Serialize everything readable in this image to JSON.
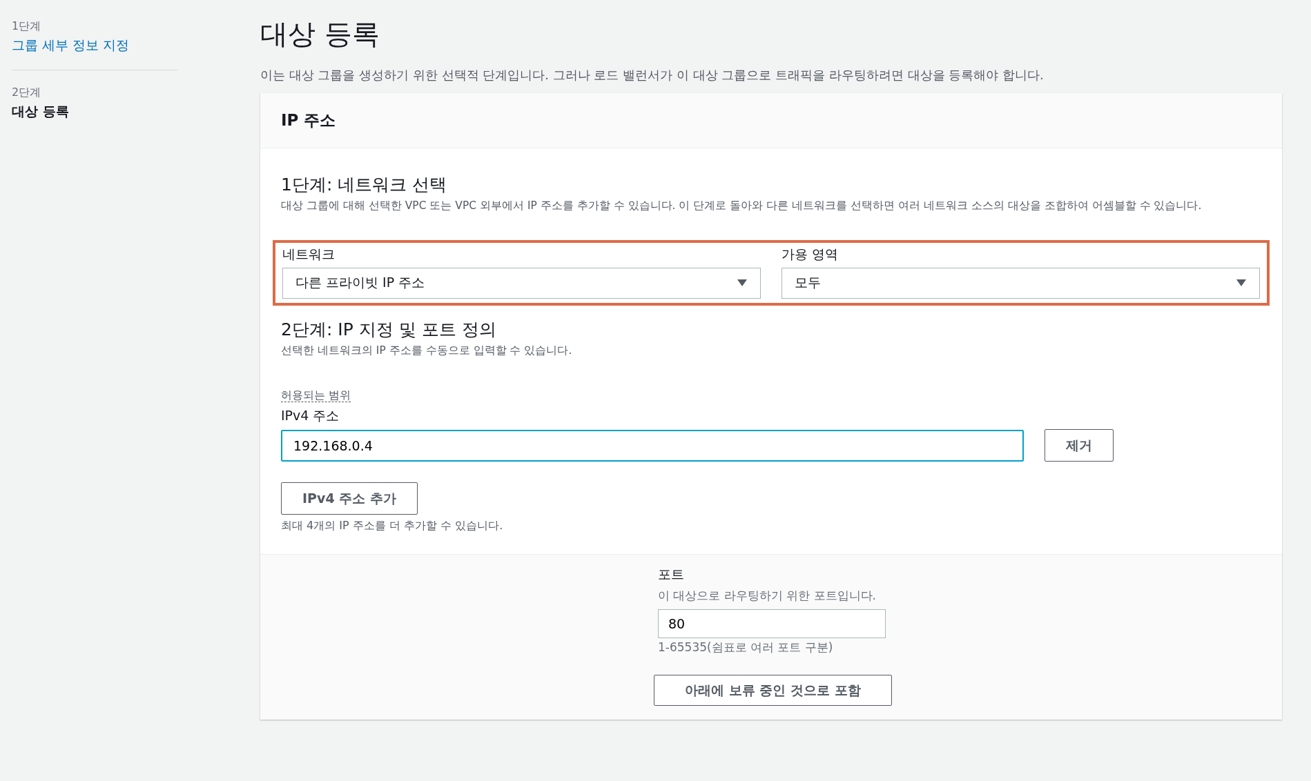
{
  "sidebar": {
    "steps": [
      {
        "step": "1단계",
        "label": "그룹 세부 정보 지정",
        "selected": false
      },
      {
        "step": "2단계",
        "label": "대상 등록",
        "selected": true
      }
    ]
  },
  "page": {
    "title": "대상 등록",
    "description": "이는 대상 그룹을 생성하기 위한 선택적 단계입니다. 그러나 로드 밸런서가 이 대상 그룹으로 트래픽을 라우팅하려면 대상을 등록해야 합니다."
  },
  "panel": {
    "title": "IP 주소",
    "step1": {
      "heading": "1단계: 네트워크 선택",
      "description": "대상 그룹에 대해 선택한 VPC 또는 VPC 외부에서 IP 주소를 추가할 수 있습니다. 이 단계로 돌아와 다른 네트워크를 선택하면 여러 네트워크 소스의 대상을 조합하여 어셈블할 수 있습니다.",
      "highlighted": true,
      "selects": [
        {
          "label": "네트워크",
          "value": "다른 프라이빗 IP 주소"
        },
        {
          "label": "가용 영역",
          "value": "모두"
        }
      ]
    },
    "step2": {
      "heading": "2단계: IP 지정 및 포트 정의",
      "description": "선택한 네트워크의 IP 주소를 수동으로 입력할 수 있습니다.",
      "allowed_range_link": "허용되는 범위",
      "ip_label": "IPv4 주소",
      "ip_value": "192.168.0.4",
      "remove_button": "제거",
      "add_button": "IPv4 주소 추가",
      "add_hint": "최대 4개의 IP 주소를 더 추가할 수 있습니다."
    },
    "port": {
      "label": "포트",
      "description": "이 대상으로 라우팅하기 위한 포트입니다.",
      "value": "80",
      "hint": "1-65535(쉼표로 여러 포트 구분)",
      "include_button": "아래에 보류 중인 것으로 포함"
    }
  }
}
